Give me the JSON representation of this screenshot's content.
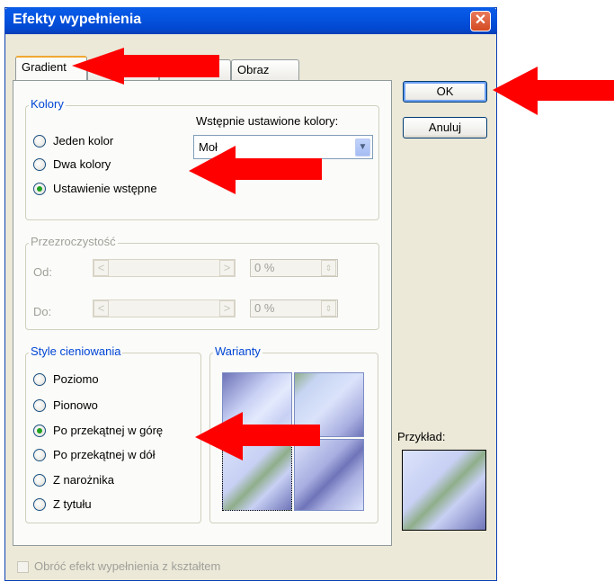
{
  "dialog": {
    "title": "Efekty wypełnienia",
    "tabs": [
      {
        "label": "Gradient"
      },
      {
        "label": "Obraz"
      }
    ],
    "ok_label": "OK",
    "cancel_label": "Anuluj",
    "example_label": "Przykład:",
    "rotate_checkbox_label": "Obróć efekt wypełnienia z kształtem"
  },
  "colors_group": {
    "legend": "Kolory",
    "options": [
      "Jeden kolor",
      "Dwa kolory",
      "Ustawienie wstępne"
    ],
    "selected": "Ustawienie wstępne",
    "preset_label": "Wstępnie ustawione kolory:",
    "preset_value": "Moł"
  },
  "transparency_group": {
    "legend": "Przezroczystość",
    "from_label": "Od:",
    "to_label": "Do:",
    "from_value": "0 %",
    "to_value": "0 %"
  },
  "shading_group": {
    "legend": "Style cieniowania",
    "options": [
      "Poziomo",
      "Pionowo",
      "Po przekątnej w górę",
      "Po przekątnej w dół",
      "Z narożnika",
      "Z tytułu"
    ],
    "selected": "Po przekątnej w górę"
  },
  "variants_group": {
    "legend": "Warianty"
  },
  "colors": {
    "title_bar": "#0454e0",
    "arrow": "#ff0000",
    "legend_text": "#0046d5",
    "gradient_light": "#dbe3fb",
    "gradient_dark": "#6e74b8",
    "gradient_green": "#8fae8a"
  }
}
